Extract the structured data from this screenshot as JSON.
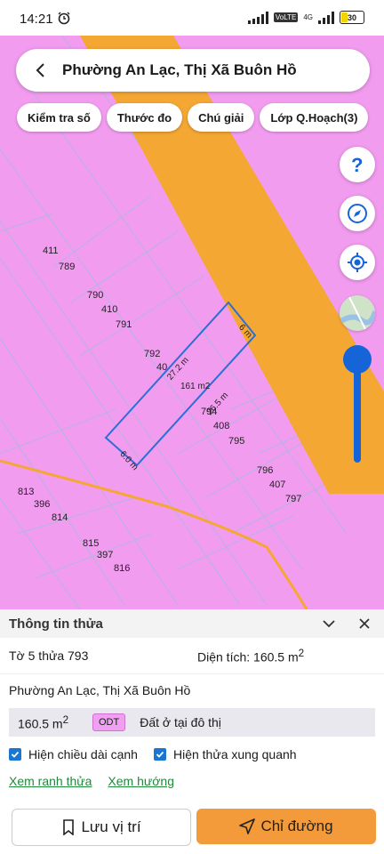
{
  "status_bar": {
    "time": "14:21",
    "network": "4G",
    "battery": "30",
    "battery_level": 0.3
  },
  "search": {
    "title": "Phường An Lạc, Thị Xã Buôn Hồ"
  },
  "chips": [
    "Kiểm tra số",
    "Thước đo",
    "Chú giải",
    "Lớp Q.Hoạch(3)"
  ],
  "map": {
    "colors": {
      "land": "#f29cf0",
      "road": "#f5a733",
      "parcel_line": "#9fb4d8",
      "selected_outline": "#2b6fd6"
    },
    "parcel_labels": [
      "411",
      "789",
      "790",
      "410",
      "791",
      "792",
      "40",
      "794",
      "408",
      "795",
      "796",
      "407",
      "797",
      "813",
      "396",
      "814",
      "815",
      "397",
      "816"
    ],
    "selected_parcel": {
      "area": "161 m2",
      "edges": [
        "6 m",
        "27.2 m",
        "6.0 m",
        "26.5 m"
      ]
    },
    "zoom_level": 0.85
  },
  "sheet": {
    "title": "Thông tin thửa",
    "sheet_parcel": "Tờ 5 thửa 793",
    "area_label": "Diện tích: 160.5 m",
    "area_sup": "2",
    "address": "Phường An Lạc, Thị Xã Buôn Hồ",
    "land_area": "160.5 m",
    "land_area_sup": "2",
    "land_code": "ODT",
    "land_type": "Đất ở tại đô thị",
    "check_edges": "Hiện chiều dài cạnh",
    "check_neighbors": "Hiện thửa xung quanh",
    "link_boundary": "Xem ranh thửa",
    "link_direction": "Xem hướng",
    "save_button": "Lưu vị trí",
    "directions_button": "Chỉ đường"
  }
}
